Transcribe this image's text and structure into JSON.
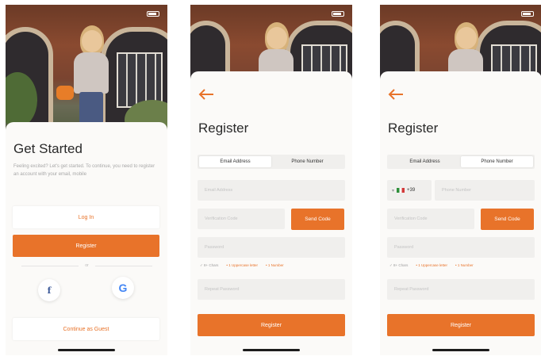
{
  "colors": {
    "accent": "#e8732a",
    "sheet": "#fbfaf8",
    "field": "#f0efed"
  },
  "screen1": {
    "title": "Get Started",
    "subtitle": "Feeling excited? Let's get started. To continue, you need to register an account with your email, mobile",
    "login_label": "Log In",
    "register_label": "Register",
    "or_label": "or",
    "facebook_glyph": "f",
    "google_glyph": "G",
    "guest_label": "Continue as Guest"
  },
  "screen2": {
    "title": "Register",
    "tabs": [
      "Email Address",
      "Phone Number"
    ],
    "active_tab": "Email Address",
    "email_placeholder": "Email Address",
    "verification_placeholder": "Verification Code",
    "send_code_label": "Send Code",
    "password_placeholder": "Password",
    "hints": [
      "8+ Chars",
      "1 Uppercase letter",
      "1 Number"
    ],
    "repeat_placeholder": "Repeat Password",
    "register_label": "Register"
  },
  "screen3": {
    "title": "Register",
    "tabs": [
      "Email Address",
      "Phone Number"
    ],
    "active_tab": "Phone Number",
    "country_code": "+39",
    "phone_placeholder": "Phone Number",
    "verification_placeholder": "Verification Code",
    "send_code_label": "Send Code",
    "password_placeholder": "Password",
    "hints": [
      "8+ Chars",
      "1 Uppercase letter",
      "1 Number"
    ],
    "repeat_placeholder": "Repeat Password",
    "register_label": "Register"
  }
}
